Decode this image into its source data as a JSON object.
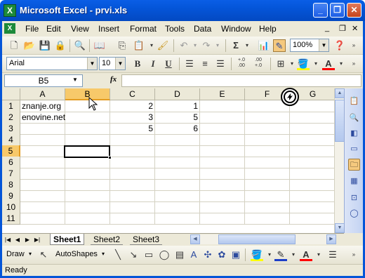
{
  "window": {
    "title": "Microsoft Excel - prvi.xls",
    "app_icon": "excel-icon",
    "app_icon_glyph": "X"
  },
  "menu": {
    "items": [
      "File",
      "Edit",
      "View",
      "Insert",
      "Format",
      "Tools",
      "Data",
      "Window",
      "Help"
    ],
    "mdi_buttons": [
      "_",
      "❐",
      "✕"
    ]
  },
  "standard_toolbar": {
    "zoom": "100%"
  },
  "formatting_toolbar": {
    "font": "Arial",
    "size": "10",
    "bold": "B",
    "italic": "I",
    "underline": "U",
    "decimal_add": "+.0\n.00",
    "decimal_remove": ".00\n+.0"
  },
  "formula_bar": {
    "name_box": "B5",
    "fx": "fx",
    "content": ""
  },
  "sheet": {
    "columns": [
      "A",
      "B",
      "C",
      "D",
      "E",
      "F",
      "G"
    ],
    "selected_column": "B",
    "rows": [
      "1",
      "2",
      "3",
      "4",
      "5",
      "6",
      "7",
      "8",
      "9",
      "10",
      "11"
    ],
    "selected_row": "5",
    "cells": {
      "A1": "znanje.org",
      "C1": "2",
      "D1": "1",
      "A2": "enovine.net",
      "C2": "3",
      "D2": "5",
      "C3": "5",
      "D3": "6"
    }
  },
  "tabs": [
    "Sheet1",
    "Sheet2",
    "Sheet3"
  ],
  "active_tab": "Sheet1",
  "drawing_toolbar": {
    "draw": "Draw",
    "autoshapes": "AutoShapes"
  },
  "status": {
    "text": "Ready"
  },
  "colors": {
    "title_blue": "#0455d8",
    "selection_orange": "#f7c96a",
    "font_color": "#ff0000",
    "fill_color": "#ffff00"
  }
}
